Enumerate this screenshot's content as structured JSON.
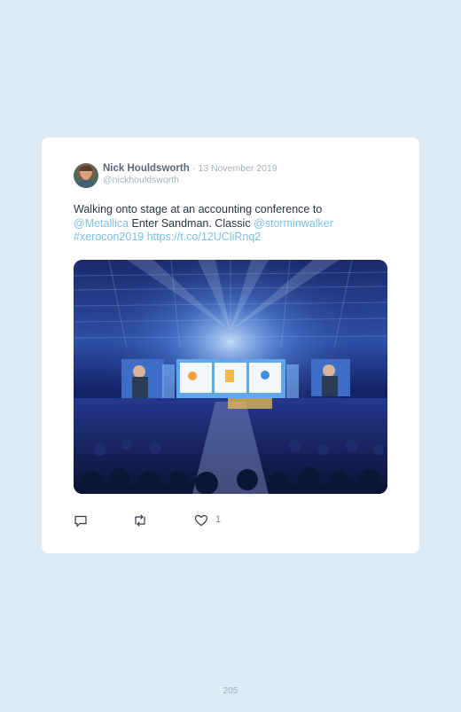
{
  "tweet": {
    "author_name": "Nick Houldsworth",
    "date": "· 13 November 2019",
    "handle": "@nickhouldsworth",
    "text_1": "Walking onto stage at an accounting conference to",
    "mention_1": "@Metallica",
    "text_2": " Enter Sandman. Classic ",
    "mention_2": "@storminwalker",
    "hashtag": "#xerocon2019",
    "link": "https://t.co/12UCliRnq2",
    "like_count": "1"
  },
  "icons": {
    "reply": "reply-icon",
    "retweet": "retweet-icon",
    "like": "heart-icon"
  },
  "colors": {
    "background": "#deebf4",
    "card": "#ffffff",
    "link": "#7cc0e8"
  },
  "page": {
    "number": "205"
  }
}
